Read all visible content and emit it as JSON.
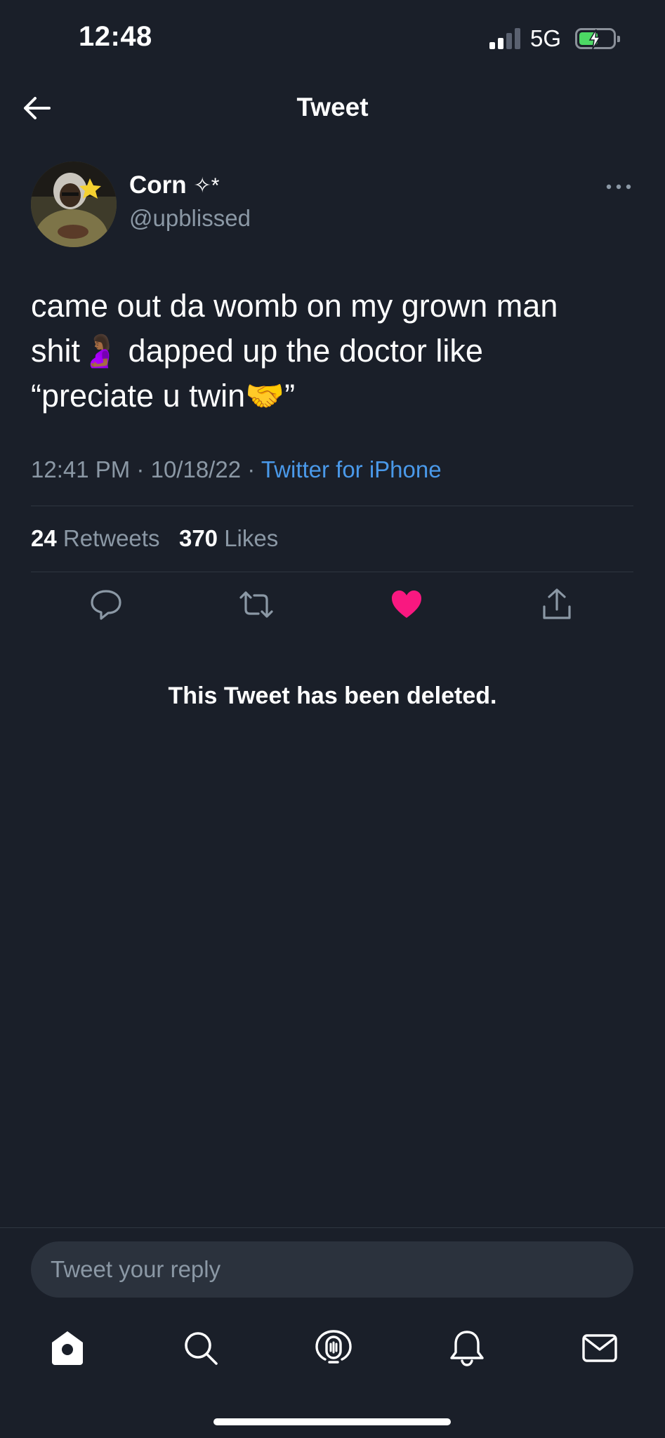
{
  "status_bar": {
    "time": "12:48",
    "network": "5G",
    "battery_color": "#4cd964"
  },
  "nav": {
    "title": "Tweet",
    "back_icon": "arrow-left-icon"
  },
  "tweet": {
    "author_name": "Corn",
    "author_sparkle": "✧*",
    "author_handle": "@upblissed",
    "text_lines": [
      "came out da womb on my grown man",
      "shit🤰🏾 dapped up the doctor like",
      "“preciate u twin🤝”"
    ],
    "time": "12:41 PM",
    "separator": "·",
    "date": "10/18/22",
    "source": "Twitter for iPhone",
    "source_color": "#4a99e9",
    "retweet_count": "24",
    "retweet_label": "Retweets",
    "like_count": "370",
    "like_label": "Likes",
    "liked": true,
    "like_color": "#f91880"
  },
  "actions": [
    "reply-icon",
    "retweet-icon",
    "like-icon",
    "share-icon"
  ],
  "deleted_notice": "This Tweet has been deleted.",
  "reply": {
    "placeholder": "Tweet your reply"
  },
  "tab_bar": [
    "home-icon",
    "search-icon",
    "spaces-icon",
    "notifications-icon",
    "messages-icon"
  ]
}
